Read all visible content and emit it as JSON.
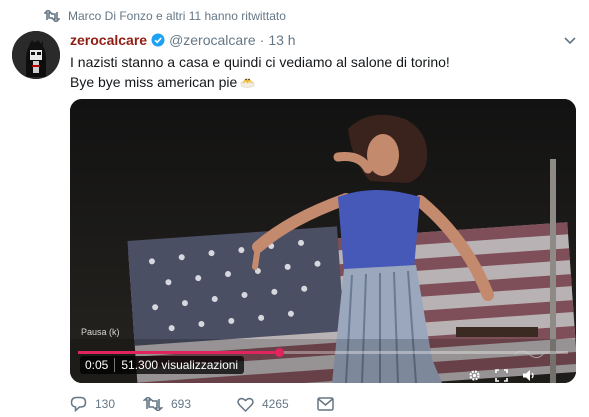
{
  "retweet_context": {
    "text": "Marco Di Fonzo e altri 11 hanno ritwittato",
    "icon": "retweet-icon"
  },
  "tweet": {
    "display_name": "zerocalcare",
    "verified": true,
    "handle": "@zerocalcare",
    "separator": "·",
    "time": "13 h",
    "text_line1": "I nazisti stanno a casa e quindi ci vediamo al salone di torino!",
    "text_line2": "Bye bye miss american pie",
    "emoji": "chick-emoji"
  },
  "video": {
    "status_label": "Pausa (k)",
    "elapsed": "0:05",
    "views": "51.300 visualizzazioni",
    "progress": 0.41,
    "controls": [
      "settings-icon",
      "fullscreen-icon",
      "volume-icon"
    ]
  },
  "actions": {
    "reply_count": "130",
    "retweet_count": "693",
    "like_count": "4265"
  },
  "colors": {
    "name": "#8f1d14",
    "secondary_text": "#657786",
    "verified": "#1da1f2",
    "progress": "#e0245e"
  }
}
